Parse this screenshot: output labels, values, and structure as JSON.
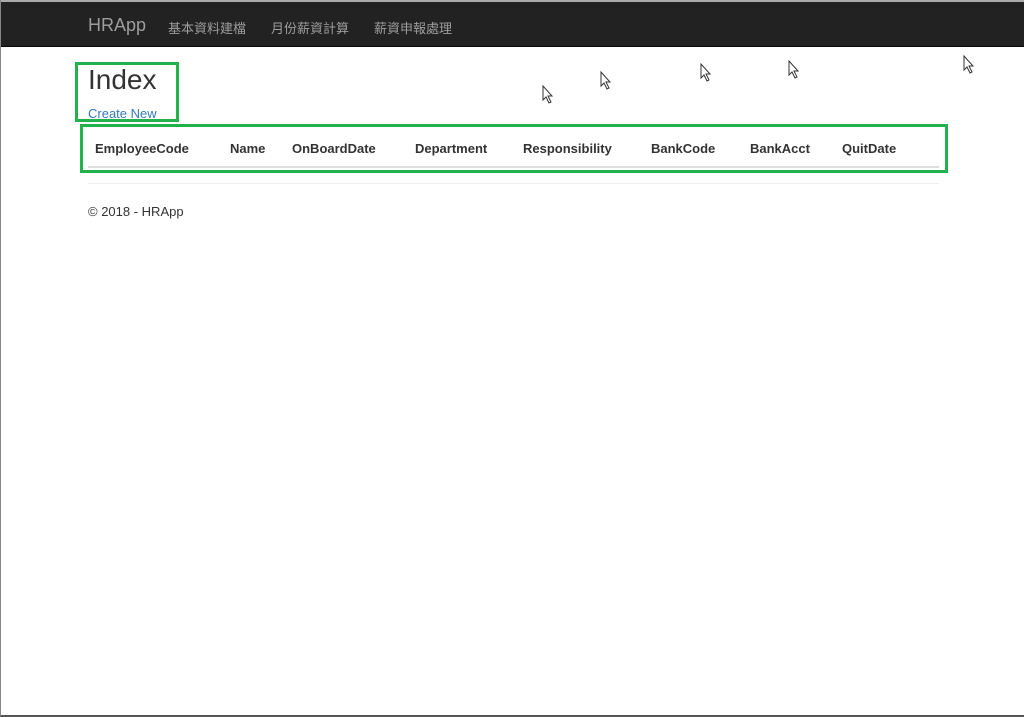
{
  "navbar": {
    "brand": "HRApp",
    "items": [
      "基本資料建檔",
      "月份薪資計算",
      "薪資申報處理"
    ]
  },
  "page": {
    "title": "Index",
    "create_new": "Create New"
  },
  "table": {
    "columns": [
      "EmployeeCode",
      "Name",
      "OnBoardDate",
      "Department",
      "Responsibility",
      "BankCode",
      "BankAcct",
      "QuitDate"
    ],
    "rows": []
  },
  "footer": {
    "text": "© 2018 - HRApp"
  },
  "colors": {
    "navbar": "#222222",
    "link": "#337ab7",
    "highlight": "#22b14c"
  }
}
